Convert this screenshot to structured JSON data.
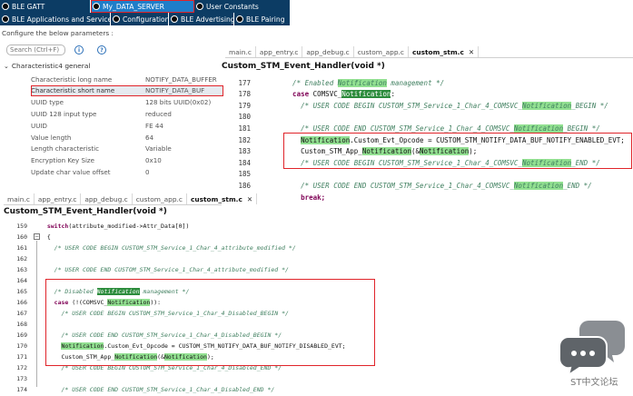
{
  "top_tabs_row1": [
    {
      "label": "BLE GATT",
      "active": false
    },
    {
      "label": "My_DATA_SERVER",
      "active": true
    },
    {
      "label": "User Constants",
      "active": false
    }
  ],
  "top_tabs_row2": [
    {
      "label": "BLE Applications and Services"
    },
    {
      "label": "Configuration"
    },
    {
      "label": "BLE Advertising"
    },
    {
      "label": "BLE Pairing"
    }
  ],
  "config": {
    "label": "Configure the below parameters :",
    "search_placeholder": "Search (Ctrl+F)",
    "group_title": "Characteristic4 general",
    "params": [
      {
        "key": "Characteristic long name",
        "value": "NOTIFY_DATA_BUFFER"
      },
      {
        "key": "Characteristic short name",
        "value": "NOTIFY_DATA_BUF"
      },
      {
        "key": "UUID type",
        "value": "128 bits UUID(0x02)"
      },
      {
        "key": "UUID 128 input type",
        "value": "reduced"
      },
      {
        "key": "UUID",
        "value": "FE 44"
      },
      {
        "key": "Value length",
        "value": "64"
      },
      {
        "key": "Length characteristic",
        "value": "Variable"
      },
      {
        "key": "Encryption Key Size",
        "value": "0x10"
      },
      {
        "key": "Update char value offset",
        "value": "0"
      }
    ]
  },
  "editor_top": {
    "tabs": [
      "main.c",
      "app_entry.c",
      "app_debug.c",
      "custom_app.c",
      "custom_stm.c"
    ],
    "active_tab": "custom_stm.c",
    "function": "Custom_STM_Event_Handler(void *)",
    "lines": [
      {
        "n": "177",
        "parts": [
          {
            "t": "    /* Enabled ",
            "c": "cm"
          },
          {
            "t": "Notification",
            "c": "cm occ"
          },
          {
            "t": " management */",
            "c": "cm"
          }
        ]
      },
      {
        "n": "178",
        "parts": [
          {
            "t": "    case ",
            "c": "kw"
          },
          {
            "t": "COMSVC_",
            "c": ""
          },
          {
            "t": "Notification",
            "c": "occ-strong"
          },
          {
            "t": ":",
            "c": ""
          }
        ]
      },
      {
        "n": "179",
        "parts": [
          {
            "t": "      /* USER CODE BEGIN CUSTOM_STM_Service_1_Char_4_COMSVC_",
            "c": "cm"
          },
          {
            "t": "Notification",
            "c": "cm occ"
          },
          {
            "t": "_BEGIN */",
            "c": "cm"
          }
        ]
      },
      {
        "n": "180",
        "parts": []
      },
      {
        "n": "181",
        "parts": [
          {
            "t": "      /* USER CODE END CUSTOM_STM_Service_1_Char_4_COMSVC_",
            "c": "cm"
          },
          {
            "t": "Notification",
            "c": "cm occ"
          },
          {
            "t": "_BEGIN */",
            "c": "cm"
          }
        ]
      },
      {
        "n": "182",
        "parts": [
          {
            "t": "      ",
            "c": ""
          },
          {
            "t": "Notification",
            "c": "occ"
          },
          {
            "t": ".Custom_Evt_Opcode = CUSTOM_STM_NOTIFY_DATA_BUF_NOTIFY_ENABLED_EVT;",
            "c": ""
          }
        ]
      },
      {
        "n": "183",
        "parts": [
          {
            "t": "      Custom_STM_App_",
            "c": ""
          },
          {
            "t": "Notification",
            "c": "occ"
          },
          {
            "t": "(&",
            "c": ""
          },
          {
            "t": "Notification",
            "c": "occ"
          },
          {
            "t": ");",
            "c": ""
          }
        ]
      },
      {
        "n": "184",
        "parts": [
          {
            "t": "      /* USER CODE BEGIN CUSTOM_STM_Service_1_Char_4_COMSVC_",
            "c": "cm"
          },
          {
            "t": "Notification",
            "c": "cm occ"
          },
          {
            "t": "_END */",
            "c": "cm"
          }
        ]
      },
      {
        "n": "185",
        "parts": []
      },
      {
        "n": "186",
        "parts": [
          {
            "t": "      /* USER CODE END CUSTOM_STM_Service_1_Char_4_COMSVC_",
            "c": "cm"
          },
          {
            "t": "Notification",
            "c": "cm occ"
          },
          {
            "t": "_END */",
            "c": "cm"
          }
        ]
      },
      {
        "n": "187",
        "parts": [
          {
            "t": "      break;",
            "c": "kw"
          }
        ]
      }
    ]
  },
  "editor_bottom": {
    "tabs": [
      "main.c",
      "app_entry.c",
      "app_debug.c",
      "custom_app.c",
      "custom_stm.c"
    ],
    "active_tab": "custom_stm.c",
    "function": "Custom_STM_Event_Handler(void *)",
    "lines": [
      {
        "n": "159",
        "parts": [
          {
            "t": "  switch",
            "c": "kw"
          },
          {
            "t": "(attribute_modified->Attr_Data[0])",
            "c": ""
          }
        ]
      },
      {
        "n": "160",
        "parts": [
          {
            "t": "  {",
            "c": ""
          }
        ]
      },
      {
        "n": "161",
        "parts": [
          {
            "t": "    /* USER CODE BEGIN CUSTOM_STM_Service_1_Char_4_attribute_modified */",
            "c": "cm"
          }
        ]
      },
      {
        "n": "162",
        "parts": []
      },
      {
        "n": "163",
        "parts": [
          {
            "t": "    /* USER CODE END CUSTOM_STM_Service_1_Char_4_attribute_modified */",
            "c": "cm"
          }
        ]
      },
      {
        "n": "164",
        "parts": []
      },
      {
        "n": "165",
        "parts": [
          {
            "t": "    /* Disabled ",
            "c": "cm"
          },
          {
            "t": "Notification",
            "c": "cm occ-strong"
          },
          {
            "t": " management */",
            "c": "cm"
          }
        ]
      },
      {
        "n": "166",
        "parts": [
          {
            "t": "    case ",
            "c": "kw"
          },
          {
            "t": "(!(COMSVC_",
            "c": ""
          },
          {
            "t": "Notification",
            "c": "occ"
          },
          {
            "t": ")):",
            "c": ""
          }
        ]
      },
      {
        "n": "167",
        "parts": [
          {
            "t": "      /* USER CODE BEGIN CUSTOM_STM_Service_1_Char_4_Disabled_BEGIN */",
            "c": "cm"
          }
        ]
      },
      {
        "n": "168",
        "parts": []
      },
      {
        "n": "169",
        "parts": [
          {
            "t": "      /* USER CODE END CUSTOM_STM_Service_1_Char_4_Disabled_BEGIN */",
            "c": "cm"
          }
        ]
      },
      {
        "n": "170",
        "parts": [
          {
            "t": "      ",
            "c": ""
          },
          {
            "t": "Notification",
            "c": "occ"
          },
          {
            "t": ".Custom_Evt_Opcode = CUSTOM_STM_NOTIFY_DATA_BUF_NOTIFY_DISABLED_EVT;",
            "c": ""
          }
        ]
      },
      {
        "n": "171",
        "parts": [
          {
            "t": "      Custom_STM_App_",
            "c": ""
          },
          {
            "t": "Notification",
            "c": "occ"
          },
          {
            "t": "(&",
            "c": ""
          },
          {
            "t": "Notification",
            "c": "occ"
          },
          {
            "t": ");",
            "c": ""
          }
        ]
      },
      {
        "n": "172",
        "parts": [
          {
            "t": "      /* USER CODE BEGIN CUSTOM_STM_Service_1_Char_4_Disabled_END */",
            "c": "cm"
          }
        ]
      },
      {
        "n": "173",
        "parts": []
      },
      {
        "n": "174",
        "parts": [
          {
            "t": "      /* USER CODE END CUSTOM_STM_Service_1_Char_4_Disabled_END */",
            "c": "cm"
          }
        ]
      },
      {
        "n": "175",
        "parts": [
          {
            "t": "      break;",
            "c": "kw"
          }
        ]
      }
    ]
  },
  "watermark": {
    "text": "ST中文论坛",
    "color": "#5f6469"
  }
}
